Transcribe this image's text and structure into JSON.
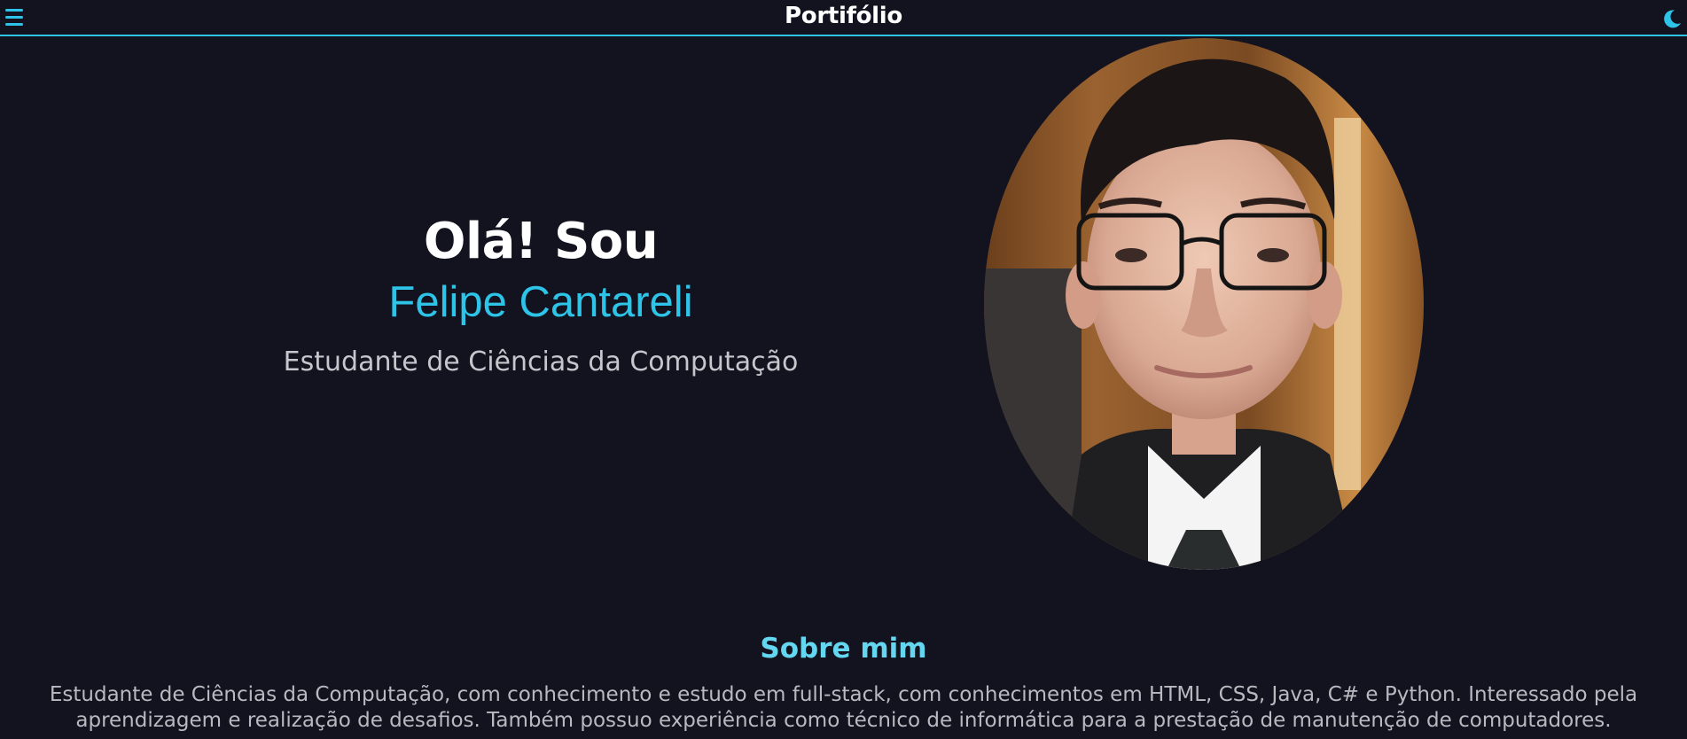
{
  "header": {
    "title": "Portifólio",
    "menu_icon": "hamburger-menu-icon",
    "theme_icon": "moon-icon"
  },
  "hero": {
    "greeting": "Olá! Sou",
    "name": "Felipe Cantareli",
    "role": "Estudante de Ciências da Computação",
    "photo_alt": "Foto de Felipe Cantareli"
  },
  "about": {
    "title": "Sobre mim",
    "text": "Estudante de Ciências da Computação, com conhecimento e estudo em full-stack, com conhecimentos em HTML, CSS, Java, C# e Python. Interessado pela aprendizagem e realização de desafios. Também possuo experiência como técnico de informática para a prestação de manutenção de computadores."
  },
  "colors": {
    "background": "#131320",
    "accent": "#2ec4e8",
    "section_title": "#65d6f0",
    "text": "#ffffff",
    "muted_text": "#c6c6cc"
  }
}
